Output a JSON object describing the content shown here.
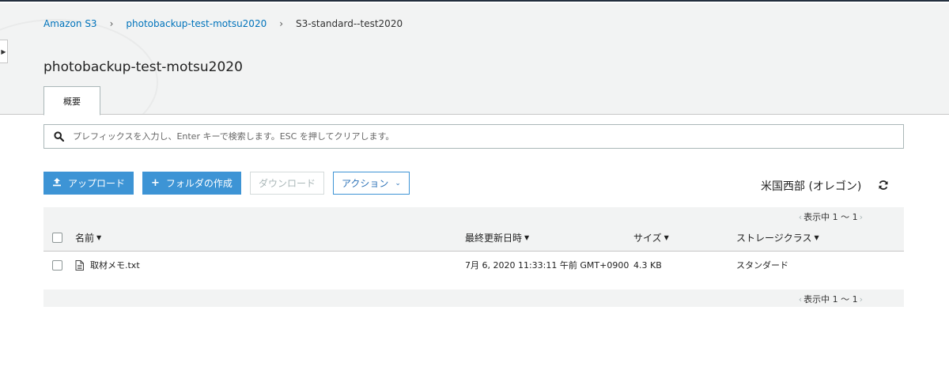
{
  "breadcrumb": {
    "root": "Amazon S3",
    "bucket": "photobackup-test-motsu2020",
    "current": "S3-standard--test2020"
  },
  "title": "photobackup-test-motsu2020",
  "tabs": [
    {
      "label": "概要"
    }
  ],
  "search": {
    "placeholder": "プレフィックスを入力し、Enter キーで検索します。ESC を押してクリアします。"
  },
  "toolbar": {
    "upload": "アップロード",
    "create_folder": "フォルダの作成",
    "download": "ダウンロード",
    "actions": "アクション"
  },
  "region": "米国西部 (オレゴン)",
  "pager": {
    "text": "表示中 1 ～ 1"
  },
  "table": {
    "columns": {
      "name": "名前",
      "modified": "最終更新日時",
      "size": "サイズ",
      "storage_class": "ストレージクラス"
    },
    "rows": [
      {
        "name": "取材メモ.txt",
        "modified": "7月 6, 2020 11:33:11 午前 GMT+0900",
        "size": "4.3 KB",
        "storage_class": "スタンダード"
      }
    ]
  },
  "colors": {
    "primary": "#3d94d5",
    "link": "#0073bb",
    "header_bg": "#f2f3f3",
    "top_border": "#232f3e"
  },
  "icons": [
    "caret-right-icon",
    "search-icon",
    "upload-icon",
    "plus-icon",
    "chevron-down-icon",
    "refresh-icon",
    "sort-down-icon",
    "file-text-icon",
    "chevron-left-icon",
    "chevron-right-icon"
  ]
}
